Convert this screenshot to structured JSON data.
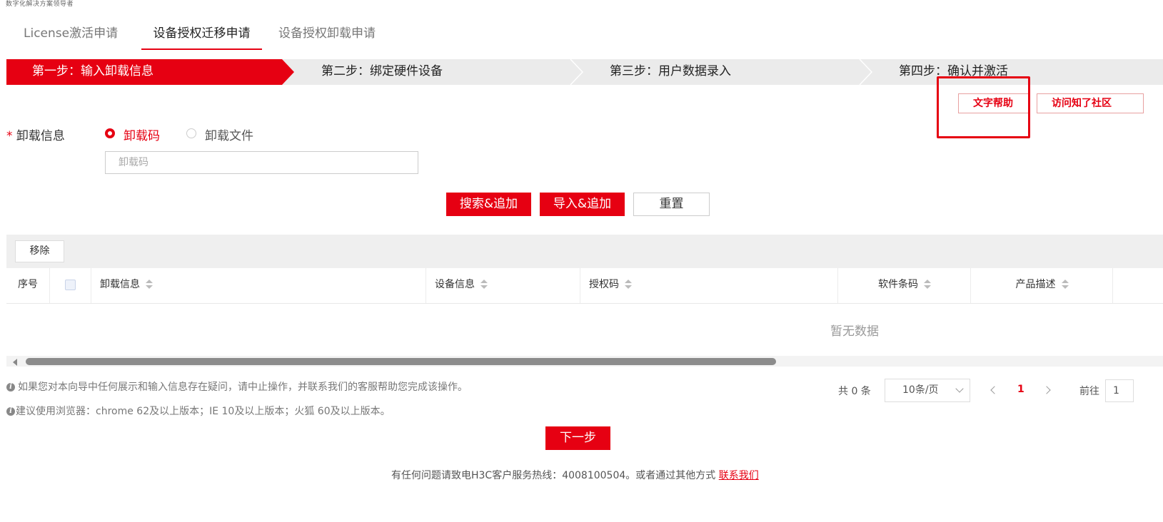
{
  "slogan": "数字化解决方案领导者",
  "tabs": [
    {
      "label": "License激活申请"
    },
    {
      "label": "设备授权迁移申请",
      "active": true
    },
    {
      "label": "设备授权卸载申请"
    }
  ],
  "steps": [
    {
      "label": "第一步：输入卸载信息",
      "active": true
    },
    {
      "label": "第二步：绑定硬件设备"
    },
    {
      "label": "第三步：用户数据录入"
    },
    {
      "label": "第四步：确认并激活"
    }
  ],
  "help": {
    "text_help": "文字帮助",
    "community": "访问知了社区"
  },
  "form": {
    "required_mark": "*",
    "label": "卸载信息",
    "radio_code": "卸载码",
    "radio_file": "卸载文件",
    "input_placeholder": "卸载码",
    "input_value": ""
  },
  "actions": {
    "search_add": "搜索&追加",
    "import_add": "导入&追加",
    "reset": "重置"
  },
  "table": {
    "remove": "移除",
    "columns": [
      "序号",
      "卸载信息",
      "设备信息",
      "授权码",
      "软件条码",
      "产品描述"
    ],
    "empty_text": "暂无数据"
  },
  "notes": {
    "note1": "如果您对本向导中任何展示和输入信息存在疑问，请中止操作，并联系我们的客服帮助您完成该操作。",
    "note2": "建议使用浏览器：chrome 62及以上版本；IE 10及以上版本；火狐 60及以上版本。"
  },
  "pagination": {
    "total": "共 0 条",
    "page_size": "10条/页",
    "current_page": "1",
    "goto_label": "前往",
    "goto_value": "1"
  },
  "next_button": "下一步",
  "footer": {
    "text": "有任何问题请致电H3C客户服务热线：4008100504。或者通过其他方式 ",
    "link": "联系我们"
  },
  "colors": {
    "brand_red": "#e60012",
    "step_bg": "#ebebeb"
  }
}
